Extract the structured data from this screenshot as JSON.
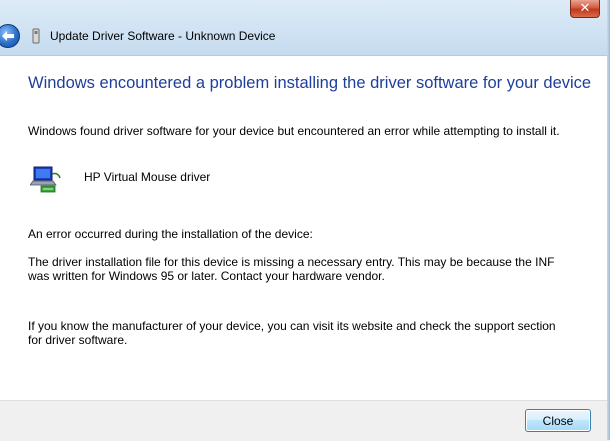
{
  "window": {
    "close_glyph": "✕",
    "title": "Update Driver Software - Unknown Device"
  },
  "main": {
    "heading": "Windows encountered a problem installing the driver software for your device",
    "intro": "Windows found driver software for your device but encountered an error while attempting to install it.",
    "device_name": "HP Virtual Mouse driver",
    "error_label": "An error occurred during the installation of the device:",
    "error_detail": "The driver installation file for this device is missing a necessary entry. This may be because the INF was written for Windows 95 or later. Contact your hardware vendor.",
    "support_text": "If you know the manufacturer of your device, you can visit its website and check the support section for driver software."
  },
  "footer": {
    "close_label": "Close"
  },
  "icons": {
    "back": "back-arrow-icon",
    "wizard": "driver-wizard-icon",
    "device": "network-device-icon"
  },
  "colors": {
    "heading": "#1e3f9a",
    "close_accent": "#3c7fb1",
    "window_close": "#c0391d"
  }
}
